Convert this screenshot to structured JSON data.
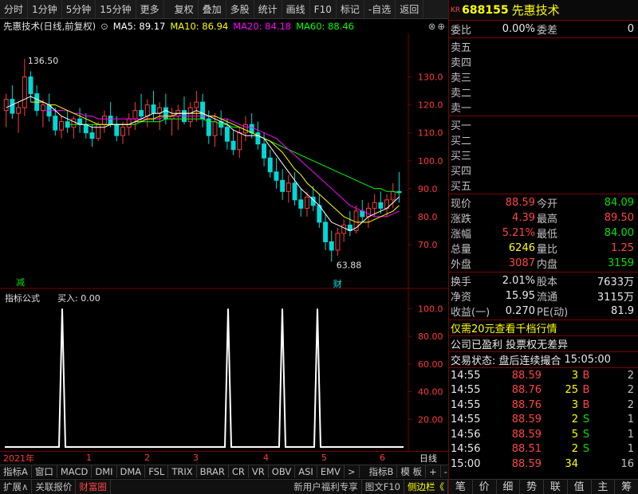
{
  "toolbar": {
    "items": [
      "分时",
      "1分钟",
      "5分钟",
      "15分钟",
      "更多",
      "复权",
      "叠加",
      "多股",
      "统计",
      "画线",
      "F10",
      "标记",
      "-自选",
      "返回"
    ]
  },
  "chart_title": {
    "name": "先惠技术(日线,前复权)",
    "ma5": "MA5: 89.17",
    "ma10": "MA10: 86.94",
    "ma20": "MA20: 84.18",
    "ma60": "MA60: 88.46"
  },
  "colors": {
    "up": "#ff3a3a",
    "down": "#00d8d8",
    "ma5": "#ffffff",
    "ma10": "#ffff00",
    "ma20": "#ff00ff",
    "ma60": "#00ff00",
    "grid": "#7a0000"
  },
  "chart_data": [
    {
      "type": "candlestick",
      "y_ticks": [
        "130.0",
        "120.0",
        "110.0",
        "100.0",
        "90.0",
        "80.0",
        "70.0"
      ],
      "ylim": [
        60,
        145
      ],
      "high_label": "136.50",
      "low_label": "63.88",
      "markers": [
        "减",
        "财"
      ],
      "candles": [
        [
          118,
          124,
          112,
          122
        ],
        [
          122,
          127,
          115,
          117
        ],
        [
          117,
          121,
          110,
          119
        ],
        [
          119,
          136.5,
          116,
          130
        ],
        [
          130,
          132,
          121,
          124
        ],
        [
          124,
          127,
          116,
          118
        ],
        [
          118,
          122,
          112,
          120
        ],
        [
          120,
          124,
          114,
          116
        ],
        [
          116,
          119,
          109,
          111
        ],
        [
          111,
          116,
          108,
          114
        ],
        [
          114,
          118,
          110,
          112
        ],
        [
          112,
          116,
          108,
          115
        ],
        [
          115,
          119,
          110,
          113
        ],
        [
          113,
          117,
          108,
          110
        ],
        [
          110,
          113,
          105,
          108
        ],
        [
          108,
          114,
          107,
          113
        ],
        [
          113,
          118,
          110,
          116
        ],
        [
          116,
          121,
          112,
          113
        ],
        [
          113,
          116,
          107,
          109
        ],
        [
          109,
          114,
          106,
          112
        ],
        [
          112,
          117,
          109,
          115
        ],
        [
          115,
          121,
          111,
          118
        ],
        [
          118,
          124,
          114,
          116
        ],
        [
          116,
          122,
          112,
          120
        ],
        [
          120,
          125,
          114,
          117
        ],
        [
          117,
          121,
          111,
          119
        ],
        [
          119,
          124,
          113,
          115
        ],
        [
          115,
          119,
          109,
          116
        ],
        [
          116,
          120,
          111,
          118
        ],
        [
          118,
          123,
          113,
          114
        ],
        [
          114,
          121,
          112,
          119
        ],
        [
          119,
          125,
          114,
          121
        ],
        [
          121,
          124,
          112,
          115
        ],
        [
          115,
          118,
          106,
          109
        ],
        [
          109,
          117,
          105,
          114
        ],
        [
          114,
          118,
          109,
          112
        ],
        [
          112,
          115,
          104,
          107
        ],
        [
          107,
          111,
          102,
          104
        ],
        [
          104,
          112,
          101,
          110
        ],
        [
          110,
          116,
          107,
          113
        ],
        [
          113,
          117,
          108,
          110
        ],
        [
          110,
          114,
          104,
          106
        ],
        [
          106,
          110,
          98,
          101
        ],
        [
          101,
          104,
          94,
          96
        ],
        [
          96,
          101,
          90,
          93
        ],
        [
          93,
          97,
          86,
          89
        ],
        [
          89,
          95,
          85,
          92
        ],
        [
          92,
          96,
          84,
          86
        ],
        [
          86,
          90,
          80,
          83
        ],
        [
          83,
          89,
          80,
          87
        ],
        [
          87,
          91,
          82,
          84
        ],
        [
          84,
          88,
          76,
          78
        ],
        [
          78,
          81,
          68,
          71
        ],
        [
          71,
          75,
          63.88,
          68
        ],
        [
          68,
          76,
          66,
          74
        ],
        [
          74,
          79,
          71,
          77
        ],
        [
          77,
          82,
          73,
          75
        ],
        [
          75,
          84,
          74,
          82
        ],
        [
          82,
          86,
          78,
          80
        ],
        [
          80,
          85,
          76,
          83
        ],
        [
          83,
          88,
          80,
          85
        ],
        [
          85,
          89,
          81,
          83
        ],
        [
          83,
          88,
          80,
          86
        ],
        [
          86,
          92,
          83,
          89
        ],
        [
          89,
          96,
          85,
          88.59
        ]
      ],
      "ma5": [
        119,
        120,
        121,
        122,
        123,
        122,
        121,
        120,
        118,
        116,
        115,
        114,
        113,
        113,
        112,
        112,
        112,
        113,
        113,
        113,
        113,
        114,
        115,
        116,
        117,
        117,
        118,
        117,
        117,
        117,
        117,
        118,
        117,
        116,
        115,
        114,
        113,
        111,
        110,
        109,
        109,
        109,
        108,
        105,
        102,
        99,
        96,
        93,
        90,
        88,
        86,
        84,
        81,
        78,
        77,
        76,
        75,
        76,
        78,
        80,
        81,
        82,
        83,
        85,
        87
      ],
      "ma10": [
        null,
        null,
        null,
        null,
        121,
        121,
        121,
        120,
        120,
        119,
        118,
        117,
        116,
        115,
        114,
        113,
        113,
        113,
        113,
        113,
        113,
        114,
        114,
        115,
        115,
        116,
        116,
        116,
        117,
        117,
        117,
        117,
        117,
        116,
        116,
        115,
        114,
        113,
        112,
        111,
        110,
        109,
        108,
        107,
        105,
        103,
        100,
        97,
        95,
        92,
        90,
        88,
        86,
        84,
        82,
        80,
        79,
        78,
        78,
        78,
        79,
        80,
        81,
        82,
        84
      ],
      "ma20": [
        null,
        null,
        null,
        null,
        null,
        null,
        118,
        118,
        118,
        118,
        118,
        117,
        117,
        116,
        116,
        115,
        115,
        115,
        115,
        115,
        115,
        115,
        115,
        115,
        115,
        115,
        116,
        116,
        116,
        116,
        116,
        116,
        116,
        116,
        116,
        115,
        115,
        114,
        113,
        112,
        112,
        111,
        110,
        109,
        108,
        106,
        104,
        102,
        100,
        98,
        96,
        94,
        92,
        90,
        88,
        86,
        84,
        83,
        82,
        81,
        80,
        80,
        80,
        81,
        82
      ],
      "ma60": [
        null,
        null,
        null,
        null,
        null,
        null,
        null,
        null,
        null,
        null,
        113,
        113,
        113,
        113,
        113,
        113,
        113,
        113,
        113,
        113,
        113,
        113,
        114,
        114,
        114,
        114,
        115,
        115,
        115,
        115,
        115,
        115,
        115,
        114,
        114,
        113,
        113,
        112,
        112,
        111,
        110,
        109,
        108,
        107,
        106,
        105,
        104,
        103,
        102,
        101,
        100,
        99,
        98,
        97,
        96,
        95,
        94,
        93,
        92,
        91,
        90,
        90,
        89,
        89,
        88.5
      ]
    },
    {
      "type": "line",
      "title": "指标公式",
      "series_label": "买入: 0.00",
      "y_ticks": [
        "100.0",
        "80.00",
        "60.00",
        "40.00",
        "20.00"
      ],
      "ylim": [
        0,
        110
      ],
      "values": [
        0,
        0,
        0,
        0,
        0,
        0,
        0,
        0,
        0,
        0,
        0,
        0,
        0,
        0,
        0,
        0,
        0,
        0,
        100,
        0,
        0,
        0,
        0,
        0,
        0,
        0,
        0,
        0,
        0,
        0,
        0,
        0,
        0,
        0,
        0,
        0,
        0,
        0,
        0,
        0,
        0,
        0,
        0,
        0,
        0,
        0,
        0,
        0,
        0,
        0,
        0,
        0,
        0,
        0,
        0,
        0,
        0,
        0,
        0,
        0,
        0,
        0,
        0,
        0,
        0,
        0,
        0,
        0,
        0,
        0,
        100,
        0,
        0,
        0,
        0,
        0,
        0,
        0,
        0,
        0,
        0,
        0,
        0,
        0,
        0,
        0,
        0,
        100,
        0,
        0,
        0,
        0,
        0,
        0,
        0,
        0,
        0,
        0,
        100,
        0,
        0,
        0,
        0,
        0,
        0,
        0,
        0,
        0,
        0,
        0,
        0,
        0,
        0,
        0,
        0,
        0,
        0,
        0,
        0,
        0,
        0,
        0,
        0,
        0,
        0,
        0
      ]
    }
  ],
  "time_axis": {
    "labels": [
      "2021年",
      "1",
      "2",
      "3",
      "4",
      "5",
      "6"
    ],
    "right": "日线"
  },
  "tabs": [
    "指标A",
    "窗口",
    "MACD",
    "DMI",
    "DMA",
    "FSL",
    "TRIX",
    "BRAR",
    "CR",
    "VR",
    "OBV",
    "ASI",
    "EMV",
    ">",
    "指标B",
    "模 板",
    "+",
    "-"
  ],
  "statusbar": {
    "left": [
      "扩展∧",
      "关联报价",
      "财富圈"
    ],
    "right": [
      "新用户福利专享",
      "图文F10",
      "侧边栏《"
    ]
  },
  "right_panel": {
    "badge": "KR",
    "code": "688155",
    "name": "先惠技术",
    "weibi_label": "委比",
    "weibi_value": "0.00%",
    "weicha_label": "委差",
    "weicha_value": "0",
    "sell": [
      "卖五",
      "卖四",
      "卖三",
      "卖二",
      "卖一"
    ],
    "buy": [
      "买一",
      "买二",
      "买三",
      "买四",
      "买五"
    ],
    "quote": [
      [
        "现价",
        "88.59",
        "今开",
        "84.09"
      ],
      [
        "涨跌",
        "4.39",
        "最高",
        "89.50"
      ],
      [
        "涨幅",
        "5.21%",
        "最低",
        "84.00"
      ],
      [
        "总量",
        "6246",
        "量比",
        "1.25"
      ],
      [
        "外盘",
        "3087",
        "内盘",
        "3159"
      ]
    ],
    "fund": [
      [
        "换手",
        "2.01%",
        "股本",
        "7633万"
      ],
      [
        "净资",
        "15.95",
        "流通",
        "3115万"
      ],
      [
        "收益(一)",
        "0.270",
        "PE(动)",
        "81.9"
      ]
    ],
    "promo": "仅需20元查看千档行情",
    "company_note": "公司已盈利 投票权无差异",
    "trade_status": "交易状态: 盘后连续撮合",
    "trade_time": "15:05:00",
    "ticks": [
      [
        "14:55",
        "88.59",
        "3",
        "B",
        "2"
      ],
      [
        "14:55",
        "88.76",
        "25",
        "B",
        "2"
      ],
      [
        "14:55",
        "88.76",
        "3",
        "B",
        "2"
      ],
      [
        "14:55",
        "88.59",
        "2",
        "S",
        "1"
      ],
      [
        "14:56",
        "88.59",
        "5",
        "S",
        "1"
      ],
      [
        "14:56",
        "88.51",
        "2",
        "S",
        "1"
      ],
      [
        "15:00",
        "88.59",
        "34",
        "",
        "16"
      ]
    ],
    "bottom": [
      "笔",
      "价",
      "细",
      "势",
      "联",
      "值",
      "主",
      "筹"
    ]
  }
}
